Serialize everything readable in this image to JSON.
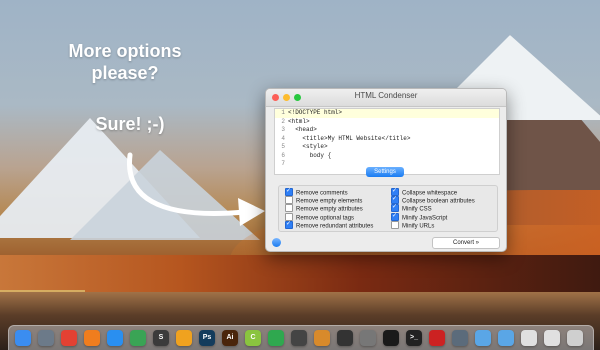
{
  "captions": {
    "line1": "More options",
    "line2": "please?",
    "line3": "Sure! ;-)"
  },
  "window": {
    "title": "HTML Condenser",
    "code_lines": [
      {
        "num": "1",
        "text": "<!DOCTYPE html>"
      },
      {
        "num": "2",
        "text": "<html>"
      },
      {
        "num": "3",
        "text": "  <head>"
      },
      {
        "num": "4",
        "text": "    <title>My HTML Website</title>"
      },
      {
        "num": "5",
        "text": "    <style>"
      },
      {
        "num": "6",
        "text": "      body {"
      },
      {
        "num": "7",
        "text": ""
      }
    ],
    "settings_label": "Settings",
    "options_left": [
      {
        "label": "Remove comments",
        "checked": true
      },
      {
        "label": "Remove empty elements",
        "checked": false
      },
      {
        "label": "Remove empty attributes",
        "checked": false
      },
      {
        "label": "Remove optional tags",
        "checked": false
      },
      {
        "label": "Remove redundant attributes",
        "checked": true
      }
    ],
    "options_right": [
      {
        "label": "Collapse whitespace",
        "checked": true
      },
      {
        "label": "Collapse boolean attributes",
        "checked": true
      },
      {
        "label": "Minify CSS",
        "checked": true
      },
      {
        "label": "Minify JavaScript",
        "checked": true
      },
      {
        "label": "Minify URLs",
        "checked": false
      }
    ],
    "convert_label": "Convert »"
  },
  "dock": {
    "icons": [
      {
        "name": "finder-icon",
        "glyph": "",
        "color": "#3b8df0"
      },
      {
        "name": "launchpad-icon",
        "glyph": "",
        "color": "#6c7a89"
      },
      {
        "name": "chrome-icon",
        "glyph": "",
        "color": "#e34133"
      },
      {
        "name": "firefox-icon",
        "glyph": "",
        "color": "#f07d1e"
      },
      {
        "name": "safari-icon",
        "glyph": "",
        "color": "#2a8ff0"
      },
      {
        "name": "maps-icon",
        "glyph": "",
        "color": "#3aa455"
      },
      {
        "name": "sublime-icon",
        "glyph": "S",
        "color": "#3b3b3b"
      },
      {
        "name": "coda-icon",
        "glyph": "",
        "color": "#f0a21f"
      },
      {
        "name": "photoshop-icon",
        "glyph": "Ps",
        "color": "#143c5c"
      },
      {
        "name": "illustrator-icon",
        "glyph": "Ai",
        "color": "#4a250b"
      },
      {
        "name": "cashculator-icon",
        "glyph": "C",
        "color": "#8ac43f"
      },
      {
        "name": "numbers-icon",
        "glyph": "",
        "color": "#2fa84f"
      },
      {
        "name": "app-icon",
        "glyph": "",
        "color": "#444"
      },
      {
        "name": "app2-icon",
        "glyph": "",
        "color": "#d88a2b"
      },
      {
        "name": "compass-icon",
        "glyph": "",
        "color": "#333"
      },
      {
        "name": "system-preferences-icon",
        "glyph": "",
        "color": "#777"
      },
      {
        "name": "app3-icon",
        "glyph": "",
        "color": "#1a1a1a"
      },
      {
        "name": "terminal-icon",
        "glyph": ">_",
        "color": "#222"
      },
      {
        "name": "ruler-icon",
        "glyph": "",
        "color": "#c22"
      },
      {
        "name": "app4-icon",
        "glyph": "",
        "color": "#5b6b7b"
      },
      {
        "name": "folder-icon",
        "glyph": "",
        "color": "#5aa6e6"
      },
      {
        "name": "folder2-icon",
        "glyph": "",
        "color": "#5aa6e6"
      },
      {
        "name": "document-icon",
        "glyph": "",
        "color": "#e0e0e0"
      },
      {
        "name": "document2-icon",
        "glyph": "",
        "color": "#e0e0e0"
      },
      {
        "name": "trash-icon",
        "glyph": "",
        "color": "#cfcfcf"
      }
    ]
  }
}
